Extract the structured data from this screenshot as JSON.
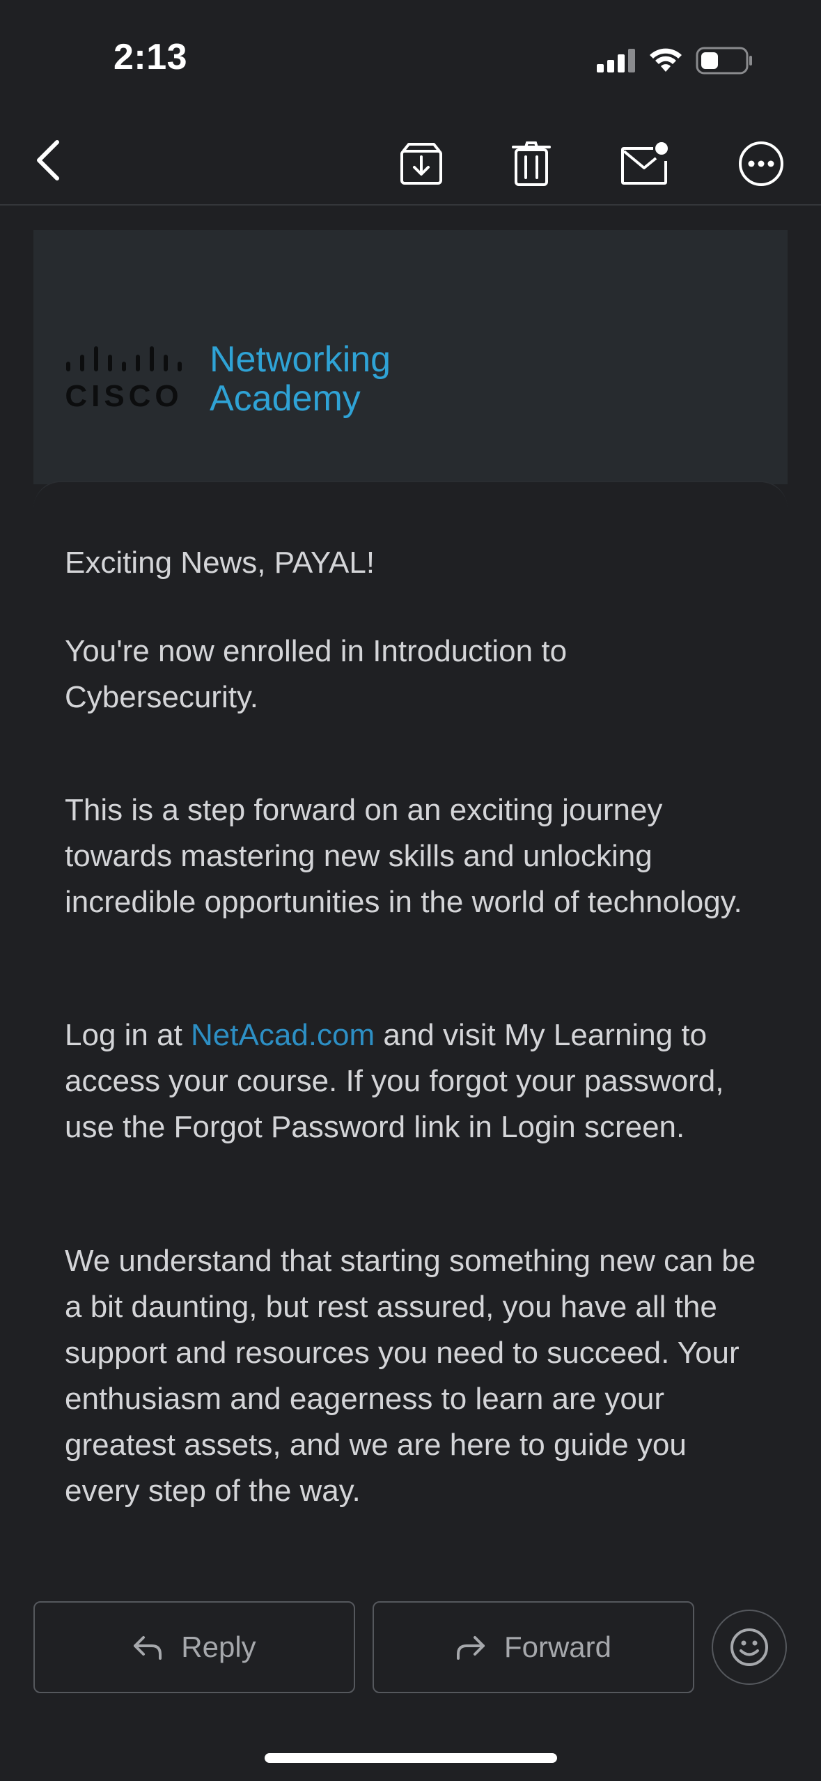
{
  "status": {
    "time": "2:13",
    "signal_icon": "cellular-signal-icon",
    "wifi_icon": "wifi-icon",
    "battery_icon": "battery-low-icon"
  },
  "toolbar": {
    "back_icon": "chevron-left-icon",
    "archive_icon": "archive-icon",
    "delete_icon": "trash-icon",
    "unread_icon": "mark-unread-icon",
    "more_icon": "more-icon"
  },
  "banner": {
    "logo_text": "CISCO",
    "product_line1": "Networking",
    "product_line2": "Academy"
  },
  "email": {
    "greeting": "Exciting News, PAYAL!",
    "para1": "You're now enrolled in Introduction to Cybersecurity.",
    "para2": "This is a step forward on an exciting journey towards mastering new skills and unlocking incredible opportunities in the world of technology.",
    "para3_prefix": "Log in at ",
    "para3_link": "NetAcad.com",
    "para3_suffix": " and visit My Learning to access your course. If you forgot your password, use the Forgot Password link in Login screen.",
    "para4": "We understand that starting something new can be a bit daunting, but rest assured, you have all the support and resources you need to succeed. Your enthusiasm and eagerness to learn are your greatest assets, and we are here to guide you every step of the way."
  },
  "actions": {
    "reply_label": "Reply",
    "forward_label": "Forward"
  },
  "colors": {
    "background": "#1f2023",
    "banner": "#272b2f",
    "accent": "#2fa3d6",
    "link": "#2d8fc4",
    "text": "#d4d5d8"
  }
}
